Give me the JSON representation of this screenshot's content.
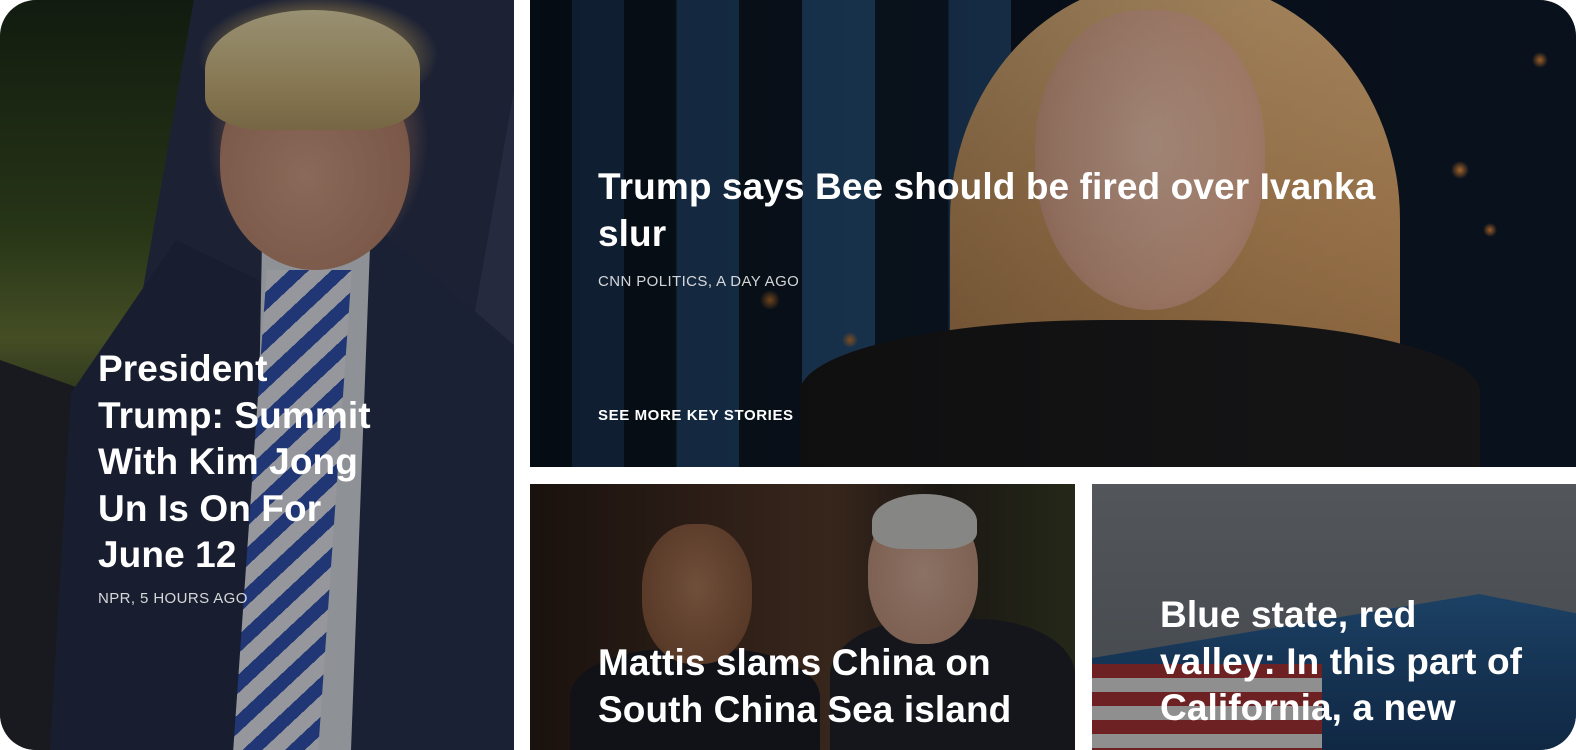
{
  "stories": {
    "left": {
      "headline": "President Trump: Summit With Kim Jong Un Is On For June 12",
      "meta": "NPR, 5 HOURS AGO"
    },
    "top": {
      "headline": "Trump says Bee should be fired over Ivanka slur",
      "meta": "CNN POLITICS, A DAY AGO",
      "see_more": "SEE MORE KEY STORIES"
    },
    "mid": {
      "headline": "Mattis slams China on South China Sea island"
    },
    "right": {
      "headline": "Blue state, red valley: In this part of California, a new"
    }
  }
}
